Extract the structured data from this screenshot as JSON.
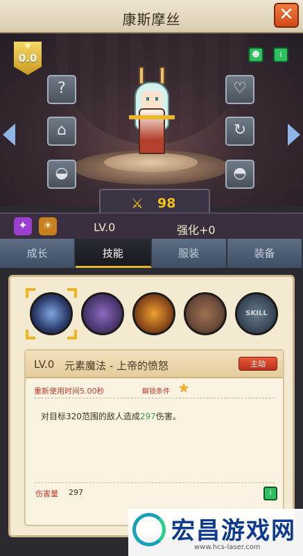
{
  "header": {
    "title": "康斯摩丝",
    "close_label": "✕"
  },
  "stage": {
    "badge_value": "0.0",
    "badge_heart": "♥",
    "left_slots": [
      "?",
      "⌂",
      "◒"
    ],
    "right_slots": [
      "♡",
      "↻",
      "◓"
    ],
    "top_buttons": [
      "☻",
      "i"
    ]
  },
  "power": {
    "icon": "⚔",
    "value": "98"
  },
  "info": {
    "level": "LV.0",
    "enhance": "强化+0"
  },
  "tabs": [
    "成长",
    "技能",
    "服装",
    "装备"
  ],
  "active_tab_index": 1,
  "skills": [
    {
      "name": "skill-1",
      "color": "#2b3a6a"
    },
    {
      "name": "skill-2",
      "color": "#4b3870"
    },
    {
      "name": "skill-3",
      "color": "#8a4a1a"
    },
    {
      "name": "skill-4",
      "color": "#6a4a3a"
    },
    {
      "name": "skill-5",
      "color": "#3a4a5a",
      "text": "SKILL"
    }
  ],
  "detail": {
    "level": "LV.0",
    "name": "元素魔法 - 上帝的愤怒",
    "type_tag": "主动",
    "cooldown_label": "重新使用时间5.00秒",
    "unlock_label": "解锁条件",
    "desc_prefix": "对目标320范围的敌人造成",
    "desc_value": "297",
    "desc_suffix": "伤害。",
    "damage_label": "伤害量",
    "damage_value": "297"
  },
  "watermark": {
    "text": "宏昌游戏网",
    "url": "www.hcs-laser.com"
  }
}
